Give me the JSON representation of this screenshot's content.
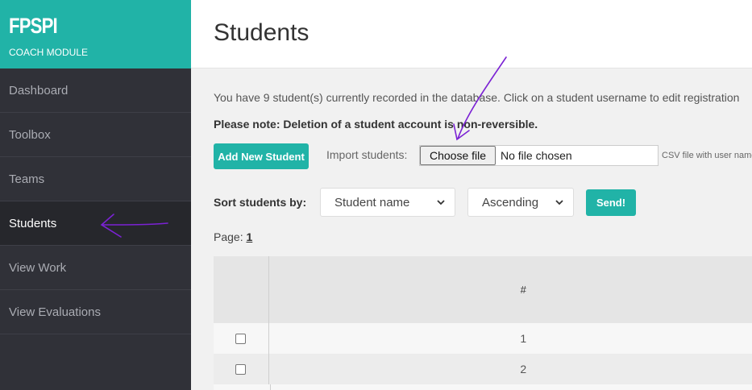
{
  "brand": {
    "logo": "FPSPI",
    "subtitle": "COACH MODULE"
  },
  "sidebar": {
    "items": [
      {
        "label": "Dashboard",
        "active": false
      },
      {
        "label": "Toolbox",
        "active": false
      },
      {
        "label": "Teams",
        "active": false
      },
      {
        "label": "Students",
        "active": true
      },
      {
        "label": "View Work",
        "active": false
      },
      {
        "label": "View Evaluations",
        "active": false
      }
    ]
  },
  "page": {
    "title": "Students"
  },
  "info_text": "You have 9 student(s) currently recorded in the database. Click on a student username to edit registration",
  "note_text": "Please note: Deletion of a student account is non-reversible.",
  "add_button": "Add New Student",
  "import": {
    "label": "Import students:",
    "choose_button": "Choose file",
    "file_status": "No file chosen",
    "hint": "CSV file with user names"
  },
  "sort": {
    "label": "Sort students by:",
    "field_selected": "Student name",
    "order_selected": "Ascending",
    "send_button": "Send!"
  },
  "pagination": {
    "label": "Page:",
    "current": "1"
  },
  "table": {
    "header_num": "#",
    "rows": [
      {
        "num": "1"
      },
      {
        "num": "2"
      }
    ]
  },
  "colors": {
    "accent": "#21b3a7",
    "sidebar_bg": "#303138",
    "annotation": "#7b22d4"
  }
}
